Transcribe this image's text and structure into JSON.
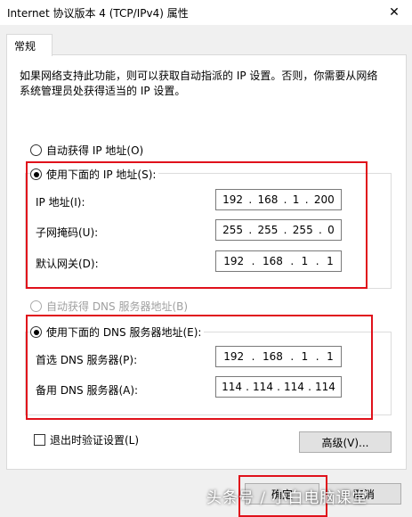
{
  "window": {
    "title": "Internet 协议版本 4 (TCP/IPv4) 属性"
  },
  "tabs": [
    {
      "label": "常规"
    }
  ],
  "description": "如果网络支持此功能，则可以获取自动指派的 IP 设置。否则，你需要从网络系统管理员处获得适当的 IP 设置。",
  "ip_mode": {
    "auto_label": "自动获得 IP 地址(O)",
    "manual_label": "使用下面的 IP 地址(S):",
    "selected": "manual"
  },
  "ip_fields": [
    {
      "label": "IP 地址(I):",
      "octets": [
        "192",
        "168",
        "1",
        "200"
      ]
    },
    {
      "label": "子网掩码(U):",
      "octets": [
        "255",
        "255",
        "255",
        "0"
      ]
    },
    {
      "label": "默认网关(D):",
      "octets": [
        "192",
        "168",
        "1",
        "1"
      ]
    }
  ],
  "dns_mode": {
    "auto_label": "自动获得 DNS 服务器地址(B)",
    "manual_label": "使用下面的 DNS 服务器地址(E):",
    "selected": "manual"
  },
  "dns_fields": [
    {
      "label": "首选 DNS 服务器(P):",
      "octets": [
        "192",
        "168",
        "1",
        "1"
      ]
    },
    {
      "label": "备用 DNS 服务器(A):",
      "octets": [
        "114",
        "114",
        "114",
        "114"
      ]
    }
  ],
  "validate_on_exit": {
    "label": "退出时验证设置(L)",
    "checked": false
  },
  "buttons": {
    "advanced": "高级(V)...",
    "ok": "确定",
    "cancel": "取消"
  },
  "watermark": "头条号 / 小白电脑课堂",
  "colors": {
    "highlight": "#e0111b",
    "panel": "#ffffff",
    "dialog_bg": "#f0f0f0"
  }
}
